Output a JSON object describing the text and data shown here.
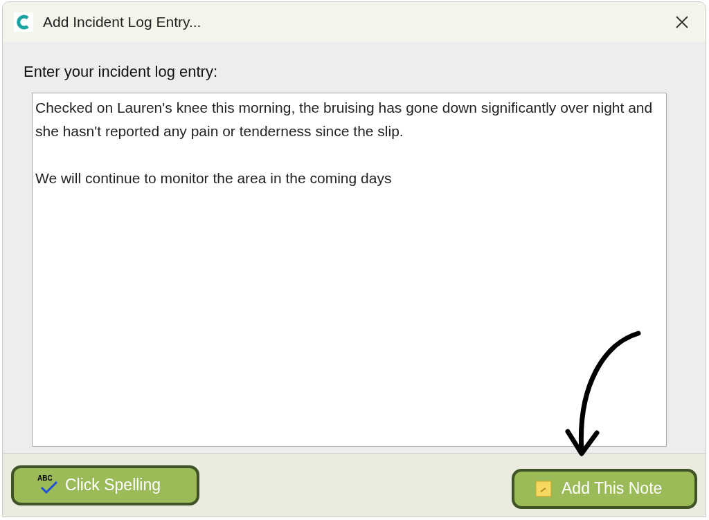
{
  "window": {
    "title": "Add Incident Log Entry..."
  },
  "prompt": "Enter your incident log entry:",
  "entry": {
    "value": "Checked on Lauren's knee this morning, the bruising has gone down significantly over night and she hasn't reported any pain or tenderness since the slip.\n\nWe will continue to monitor the area in the coming days"
  },
  "buttons": [
    {
      "kind": "spelling",
      "label": "Click Spelling",
      "icon_text": "ABC"
    },
    {
      "kind": "note",
      "label": "Add This Note"
    }
  ]
}
